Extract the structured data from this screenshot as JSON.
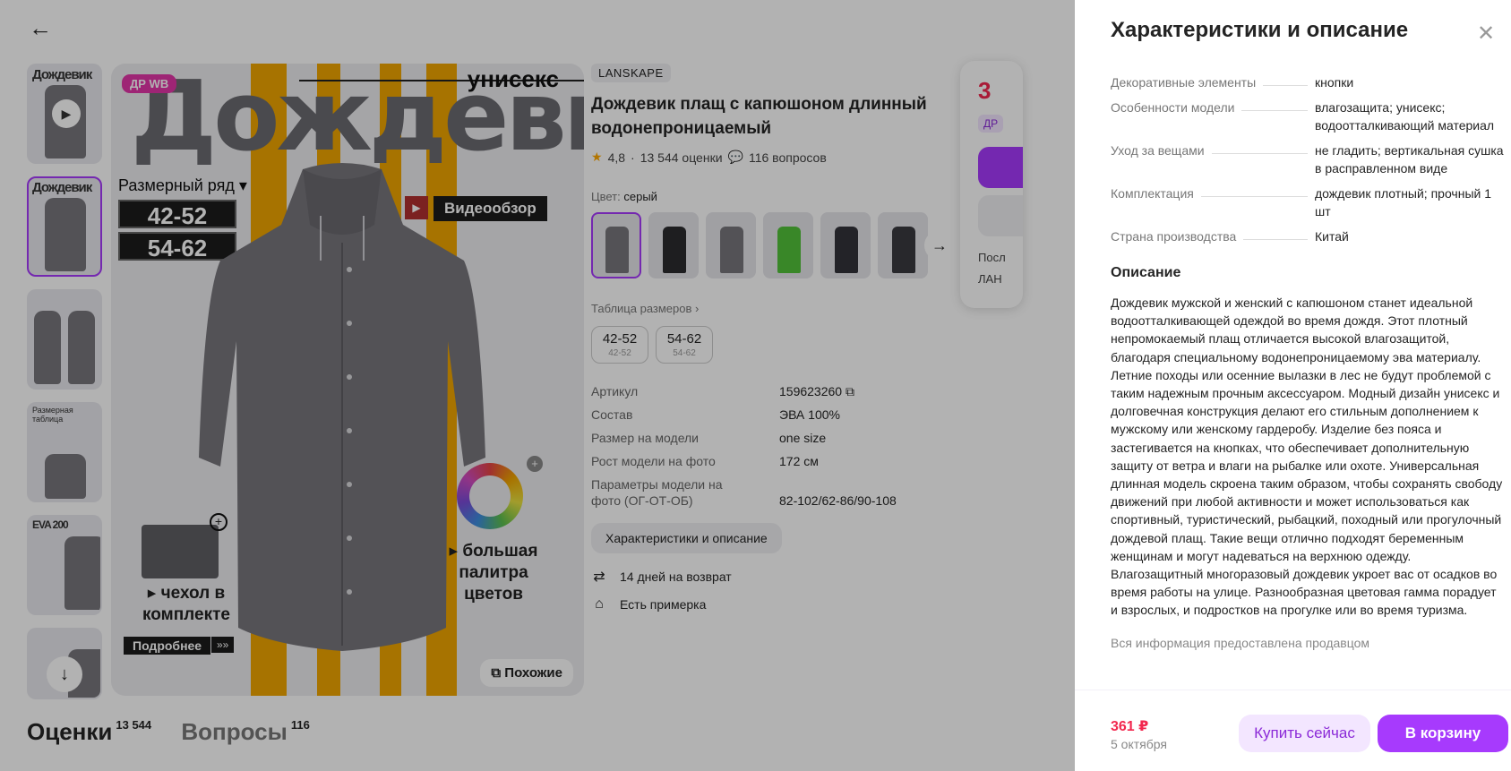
{
  "page": {
    "back_icon": "arrow-left-icon",
    "hero": {
      "badge": "ДР WB",
      "title": "Дождевик",
      "unisex": "унисекс",
      "size_label": "Размерный ряд ▾",
      "sizes": [
        "42-52",
        "54-62"
      ],
      "video_label": "Видеообзор",
      "bag_text": "▸ чехол в комплекте",
      "more_label": "Подробнее",
      "more_arrows": "»»",
      "palette_text": "▸ большая палитра цветов",
      "similar_label": "Похожие"
    },
    "thumbs": [
      {
        "title": "Дождевик",
        "play": "▶"
      },
      {
        "title": "Дождевик"
      },
      {
        "title": ""
      },
      {
        "title": "Размерная таблица"
      },
      {
        "title": "EVA 200"
      },
      {
        "title": "",
        "scroll": "↓"
      }
    ],
    "info": {
      "brand": "LANSKAPE",
      "title": "Дождевик плащ с капюшоном длинный водонепроницаемый",
      "rating": "4,8",
      "reviews": "13 544 оценки",
      "questions": "116 вопросов",
      "color_label": "Цвет:",
      "color_value": "серый",
      "swatch_colors": [
        "#77767c",
        "#2b2b2f",
        "#77767c",
        "#52c23a",
        "#33333a",
        "#3a3a40"
      ],
      "size_table_link": "Таблица размеров ›",
      "size_options": [
        {
          "main": "42-52",
          "sub": "42-52"
        },
        {
          "main": "54-62",
          "sub": "54-62"
        }
      ],
      "params": [
        {
          "k": "Артикул",
          "v": "159623260 ⧉"
        },
        {
          "k": "Состав",
          "v": "ЭВА 100%"
        },
        {
          "k": "Размер на модели",
          "v": "one size"
        },
        {
          "k": "Рост модели на фото",
          "v": "172 см"
        },
        {
          "k": "Параметры модели на фото (ОГ-ОТ-ОБ)",
          "v": "82-102/62-86/90-108"
        }
      ],
      "char_button": "Характеристики и описание",
      "features": [
        {
          "icon": "⇄",
          "text": "14 дней на возврат"
        },
        {
          "icon": "⌂",
          "text": "Есть примерка"
        }
      ]
    },
    "buy_card": {
      "price_partial": "3",
      "badge_partial": "ДР",
      "line1": "Посл",
      "line2": "ЛАН"
    },
    "tabs": [
      {
        "label": "Оценки",
        "count": "13 544"
      },
      {
        "label": "Вопросы",
        "count": "116"
      }
    ]
  },
  "panel": {
    "title": "Характеристики и описание",
    "close_icon": "close-icon",
    "specs": [
      {
        "k": "Декоративные элементы",
        "v": "кнопки"
      },
      {
        "k": "Особенности модели",
        "v": "влагозащита; унисекс; водоотталкивающий материал"
      },
      {
        "k": "Уход за вещами",
        "v": "не гладить; вертикальная сушка в расправленном виде"
      },
      {
        "k": "Комплектация",
        "v": "дождевик плотный; прочный 1 шт"
      },
      {
        "k": "Страна производства",
        "v": "Китай"
      }
    ],
    "description_title": "Описание",
    "description": "Дождевик мужской и женский с капюшоном станет идеальной водоотталкивающей одеждой во время дождя. Этот плотный непромокаемый плащ отличается высокой влагозащитой, благодаря специальному водонепроницаемому эва материалу. Летние походы или осенние вылазки в лес не будут проблемой с таким надежным прочным аксессуаром. Модный дизайн унисекс и долговечная конструкция делают его стильным дополнением к мужскому или женскому гардеробу. Изделие без пояса и застегивается на кнопках, что обеспечивает дополнительную защиту от ветра и влаги на рыбалке или охоте. Универсальная длинная модель скроена таким образом, чтобы сохранять свободу движений при любой активности и может использоваться как спортивный, туристический, рыбацкий, походный или прогулочный дождевой плащ. Такие вещи отлично подходят беременным женщинам и могут надеваться на верхнюю одежду. Влагозащитный многоразовый дождевик укроет вас от осадков во время работы на улице. Разнообразная цветовая гамма порадует и взрослых, и подростков на прогулке или во время туризма.",
    "seller_note": "Вся информация предоставлена продавцом",
    "footer": {
      "price": "361 ₽",
      "date": "5 октября",
      "buy_now": "Купить сейчас",
      "add_to_cart": "В корзину"
    }
  },
  "colors": {
    "accent": "#a73afd",
    "price": "#f2284f",
    "stripe": "#f0a500"
  }
}
